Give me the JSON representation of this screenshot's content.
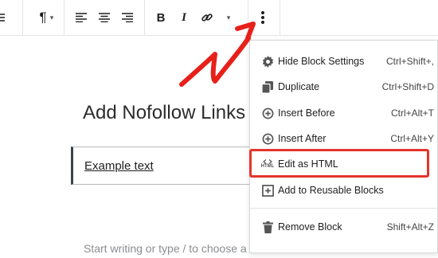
{
  "toolbar": {
    "icons": [
      "list-lines-icon",
      "paragraph-icon",
      "align-left-icon",
      "align-center-icon",
      "align-right-icon",
      "bold-icon",
      "italic-icon",
      "link-icon",
      "more-options-icon"
    ],
    "paragraph_glyph": "¶",
    "bold_glyph": "B",
    "italic_glyph": "I",
    "caret_glyph": "▾"
  },
  "editor": {
    "title": "Add Nofollow Links",
    "block_text": "Example text",
    "placeholder": "Start writing or type / to choose a block"
  },
  "menu": {
    "items": [
      {
        "icon": "gear-icon",
        "label": "Hide Block Settings",
        "shortcut": "Ctrl+Shift+,"
      },
      {
        "icon": "duplicate-icon",
        "label": "Duplicate",
        "shortcut": "Ctrl+Shift+D"
      },
      {
        "icon": "insert-before-icon",
        "label": "Insert Before",
        "shortcut": "Ctrl+Alt+T"
      },
      {
        "icon": "insert-after-icon",
        "label": "Insert After",
        "shortcut": "Ctrl+Alt+Y"
      },
      {
        "icon": "html-icon",
        "label": "Edit as HTML",
        "shortcut": ""
      },
      {
        "icon": "reusable-block-icon",
        "label": "Add to Reusable Blocks",
        "shortcut": ""
      },
      {
        "icon": "trash-icon",
        "label": "Remove Block",
        "shortcut": "Shift+Alt+Z"
      }
    ],
    "html_icon_text": "HTML"
  },
  "annotation": {
    "highlighted_item": "Edit as HTML",
    "highlight_color": "#e4352c",
    "arrow_color": "#e8201a"
  }
}
